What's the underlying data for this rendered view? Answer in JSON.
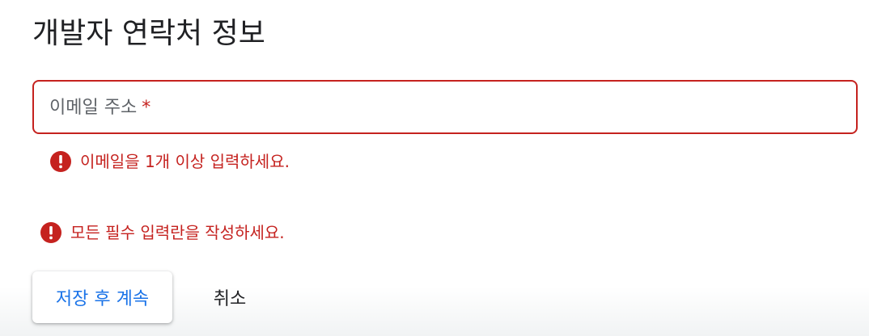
{
  "section": {
    "title": "개발자 연락처 정보"
  },
  "email_field": {
    "label": "이메일 주소",
    "required_marker": "*",
    "value": "",
    "error": "이메일을 1개 이상 입력하세요."
  },
  "form": {
    "error": "모든 필수 입력란을 작성하세요."
  },
  "actions": {
    "save_label": "저장 후 계속",
    "cancel_label": "취소"
  },
  "colors": {
    "error": "#c5221f",
    "primary": "#1a73e8",
    "text": "#202124",
    "label": "#5f6368"
  },
  "icons": {
    "error_icon": "error-icon"
  }
}
